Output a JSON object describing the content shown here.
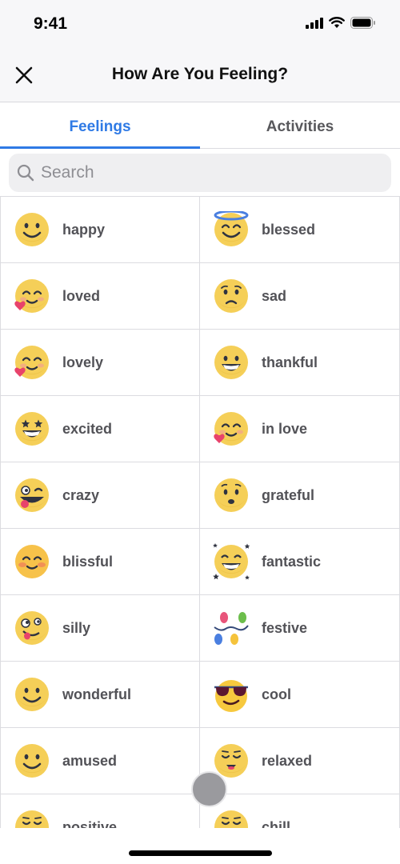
{
  "status_bar": {
    "time": "9:41",
    "icons": [
      "cellular-signal-icon",
      "wifi-icon",
      "battery-icon"
    ]
  },
  "nav": {
    "title": "How Are You Feeling?",
    "close_icon": "close-icon"
  },
  "tabs": [
    {
      "label": "Feelings",
      "active": true
    },
    {
      "label": "Activities",
      "active": false
    }
  ],
  "search": {
    "placeholder": "Search",
    "value": "",
    "icon": "search-icon"
  },
  "colors": {
    "accent": "#2f7ae5",
    "emoji_yellow": "#f5cf58",
    "label_gray": "#525257"
  },
  "feelings": [
    {
      "label": "happy",
      "icon": "smiling-face-icon"
    },
    {
      "label": "blessed",
      "icon": "smiling-face-with-halo-icon"
    },
    {
      "label": "loved",
      "icon": "smiling-face-with-heart-icon"
    },
    {
      "label": "sad",
      "icon": "sad-face-icon"
    },
    {
      "label": "lovely",
      "icon": "smiling-face-with-heart-icon"
    },
    {
      "label": "thankful",
      "icon": "grinning-face-icon"
    },
    {
      "label": "excited",
      "icon": "star-struck-face-icon"
    },
    {
      "label": "in love",
      "icon": "smiling-face-with-heart-icon"
    },
    {
      "label": "crazy",
      "icon": "zany-face-icon"
    },
    {
      "label": "grateful",
      "icon": "hopeful-face-icon"
    },
    {
      "label": "blissful",
      "icon": "blushing-face-icon"
    },
    {
      "label": "fantastic",
      "icon": "grinning-face-with-stars-icon"
    },
    {
      "label": "silly",
      "icon": "goofy-face-icon"
    },
    {
      "label": "festive",
      "icon": "string-lights-icon"
    },
    {
      "label": "wonderful",
      "icon": "smiling-face-icon"
    },
    {
      "label": "cool",
      "icon": "sunglasses-face-icon"
    },
    {
      "label": "amused",
      "icon": "smiling-face-icon"
    },
    {
      "label": "relaxed",
      "icon": "relieved-face-icon"
    },
    {
      "label": "positive",
      "icon": "relieved-face-icon"
    },
    {
      "label": "chill",
      "icon": "relieved-face-icon"
    }
  ]
}
